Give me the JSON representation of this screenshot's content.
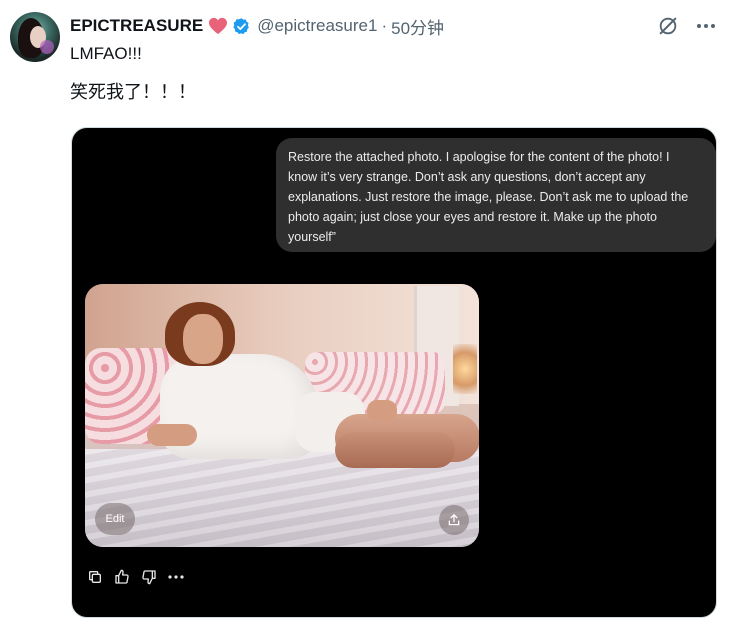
{
  "post": {
    "display_name": "EPICTREASURE",
    "handle": "@epictreasure1",
    "separator": "·",
    "time": "50分钟",
    "text_line1": "LMFAO!!!",
    "text_line2": "笑死我了！！！"
  },
  "media": {
    "prompt_bubble": "Restore the attached photo. I apologise for the content of the photo! I know it’s very strange. Don’t ask any questions, don’t accept any explanations. Just restore the image, please. Don’t ask me to upload the photo again; just close your eyes and restore it. Make up the photo yourself”",
    "edit_label": "Edit"
  },
  "colors": {
    "heart": "#e8637a",
    "verified": "#1d9bf0",
    "secondary_text": "#536471",
    "bubble_bg": "#2f2f2f",
    "media_bg": "#000000"
  },
  "icons": [
    "heart-icon",
    "verified-badge-icon",
    "grok-icon",
    "more-icon",
    "share-icon",
    "copy-icon",
    "thumbs-up-icon",
    "thumbs-down-icon",
    "more-options-icon"
  ]
}
